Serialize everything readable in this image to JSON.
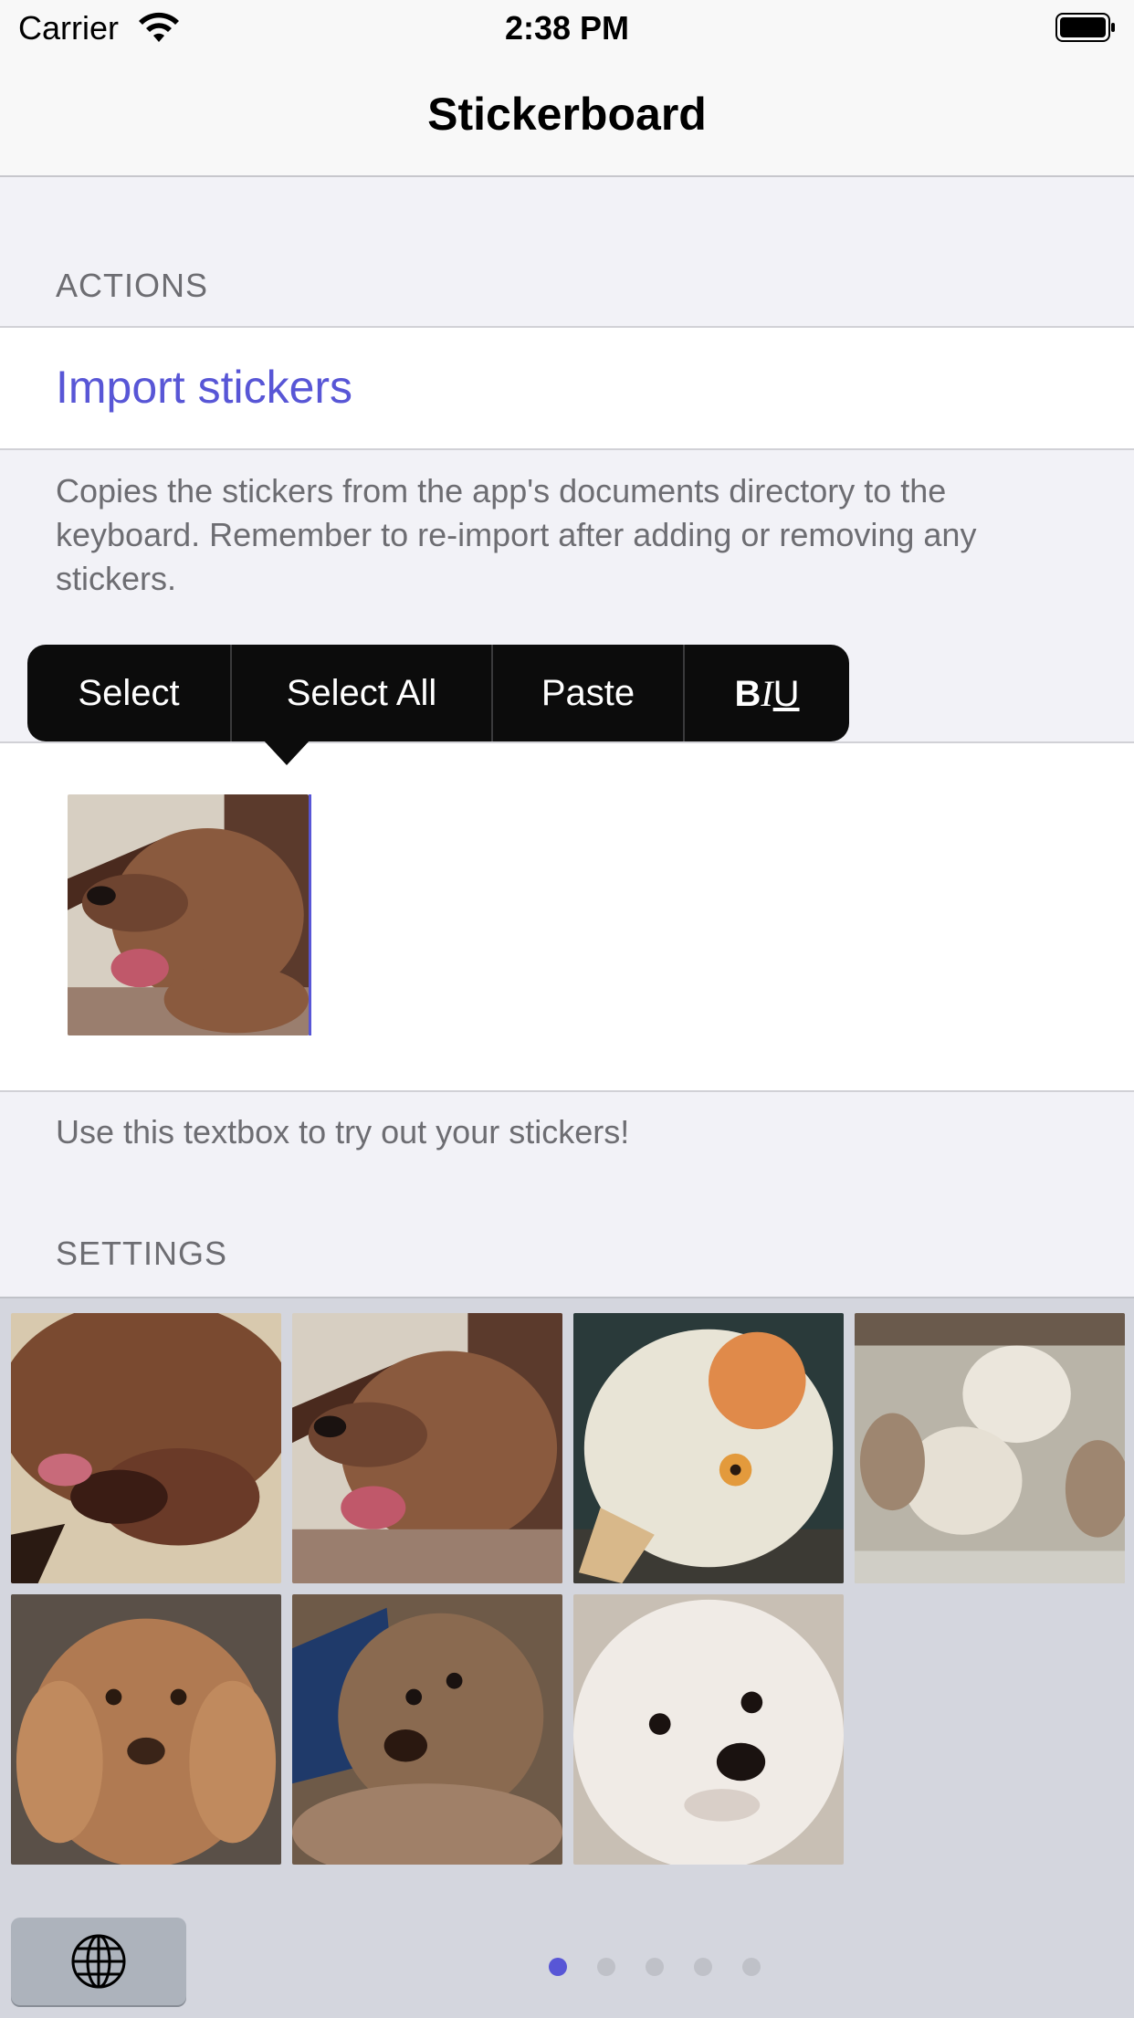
{
  "status": {
    "carrier": "Carrier",
    "time": "2:38 PM"
  },
  "nav": {
    "title": "Stickerboard"
  },
  "actions": {
    "header": "ACTIONS",
    "import_label": "Import stickers",
    "footer": "Copies the stickers from the app's documents directory to the keyboard. Remember to re-import after adding or removing any stickers."
  },
  "edit_menu": {
    "items": [
      "Select",
      "Select All",
      "Paste",
      "BIU"
    ]
  },
  "textbox": {
    "footer": "Use this textbox to try out your stickers!"
  },
  "settings": {
    "header": "SETTINGS"
  },
  "keyboard": {
    "stickers": [
      "poodle-yawning",
      "poodle-tongue-out",
      "flowerhorn-fish",
      "white-poodles-group",
      "apricot-poodle",
      "poodle-blue-pillow",
      "white-poodle-closeup"
    ],
    "page_count": 5,
    "active_page": 1,
    "accent_color": "#5856d6"
  },
  "colors": {
    "accent": "#5856d6",
    "menu_bg": "#0c0c0c"
  }
}
